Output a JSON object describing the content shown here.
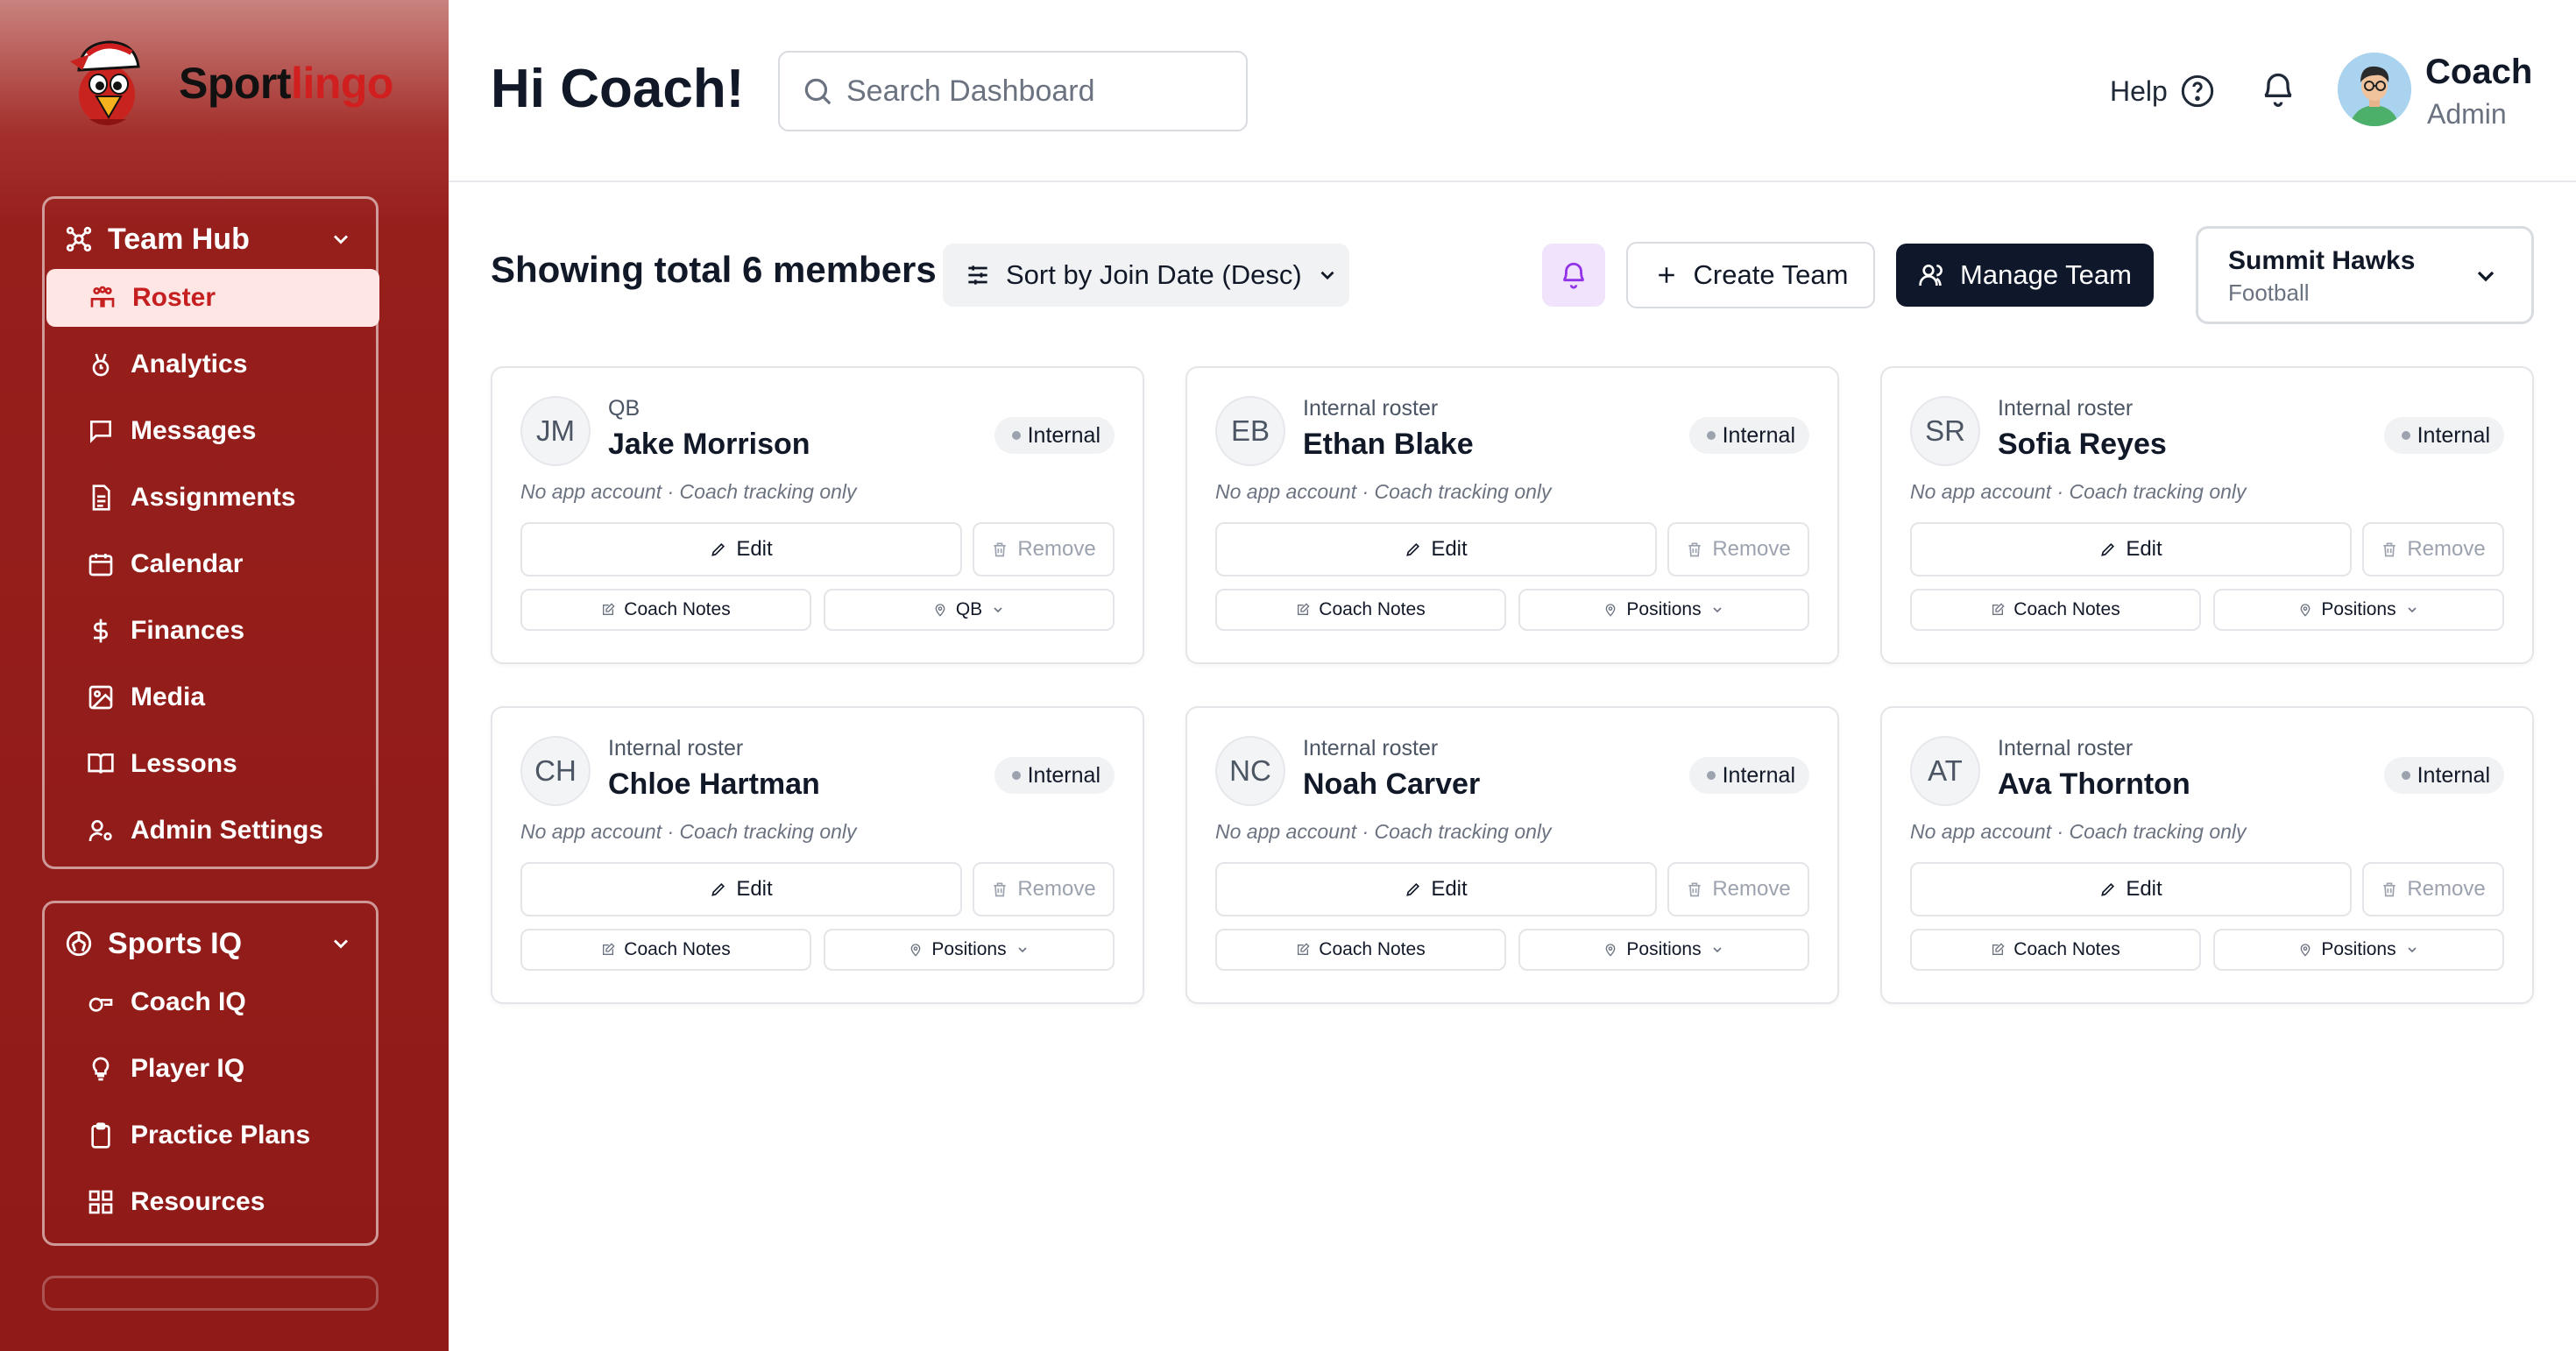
{
  "brand": {
    "name_part1": "Sport",
    "name_part2": "lingo"
  },
  "sidebar": {
    "team_hub": {
      "title": "Team Hub",
      "items": [
        {
          "label": "Roster",
          "icon": "roster-icon",
          "active": true
        },
        {
          "label": "Analytics",
          "icon": "analytics-icon"
        },
        {
          "label": "Messages",
          "icon": "messages-icon"
        },
        {
          "label": "Assignments",
          "icon": "assignments-icon"
        },
        {
          "label": "Calendar",
          "icon": "calendar-icon"
        },
        {
          "label": "Finances",
          "icon": "dollar-icon"
        },
        {
          "label": "Media",
          "icon": "media-icon"
        },
        {
          "label": "Lessons",
          "icon": "book-icon"
        },
        {
          "label": "Admin Settings",
          "icon": "admin-user-icon"
        }
      ]
    },
    "sports_iq": {
      "title": "Sports IQ",
      "items": [
        {
          "label": "Coach IQ",
          "icon": "whistle-icon"
        },
        {
          "label": "Player IQ",
          "icon": "lightbulb-icon"
        },
        {
          "label": "Practice Plans",
          "icon": "clipboard-icon"
        },
        {
          "label": "Resources",
          "icon": "grid-icon"
        }
      ]
    }
  },
  "header": {
    "greeting": "Hi Coach!",
    "search_placeholder": "Search Dashboard",
    "help_label": "Help",
    "user": {
      "name": "Coach",
      "role": "Admin"
    }
  },
  "toolbar": {
    "members_title": "Showing total 6 members",
    "sort_label": "Sort by Join Date (Desc)",
    "create_team_label": "Create Team",
    "manage_team_label": "Manage Team",
    "team": {
      "name": "Summit Hawks",
      "sport": "Football"
    }
  },
  "members": [
    {
      "initials": "JM",
      "position": "QB",
      "name": "Jake Morrison",
      "status": "Internal",
      "note": "No app account · Coach tracking only",
      "edit_label": "Edit",
      "remove_label": "Remove",
      "notes_label": "Coach Notes",
      "positions_label": "QB"
    },
    {
      "initials": "EB",
      "position": "Internal roster",
      "name": "Ethan Blake",
      "status": "Internal",
      "note": "No app account · Coach tracking only",
      "edit_label": "Edit",
      "remove_label": "Remove",
      "notes_label": "Coach Notes",
      "positions_label": "Positions"
    },
    {
      "initials": "SR",
      "position": "Internal roster",
      "name": "Sofia Reyes",
      "status": "Internal",
      "note": "No app account · Coach tracking only",
      "edit_label": "Edit",
      "remove_label": "Remove",
      "notes_label": "Coach Notes",
      "positions_label": "Positions"
    },
    {
      "initials": "CH",
      "position": "Internal roster",
      "name": "Chloe Hartman",
      "status": "Internal",
      "note": "No app account · Coach tracking only",
      "edit_label": "Edit",
      "remove_label": "Remove",
      "notes_label": "Coach Notes",
      "positions_label": "Positions"
    },
    {
      "initials": "NC",
      "position": "Internal roster",
      "name": "Noah Carver",
      "status": "Internal",
      "note": "No app account · Coach tracking only",
      "edit_label": "Edit",
      "remove_label": "Remove",
      "notes_label": "Coach Notes",
      "positions_label": "Positions"
    },
    {
      "initials": "AT",
      "position": "Internal roster",
      "name": "Ava Thornton",
      "status": "Internal",
      "note": "No app account · Coach tracking only",
      "edit_label": "Edit",
      "remove_label": "Remove",
      "notes_label": "Coach Notes",
      "positions_label": "Positions"
    }
  ],
  "colors": {
    "sidebar": "#8f1a17",
    "accent_red": "#d11f1f",
    "active_bg": "#fde6e4",
    "primary_dark": "#0f172a",
    "bell_bg": "#f0e3fb"
  }
}
